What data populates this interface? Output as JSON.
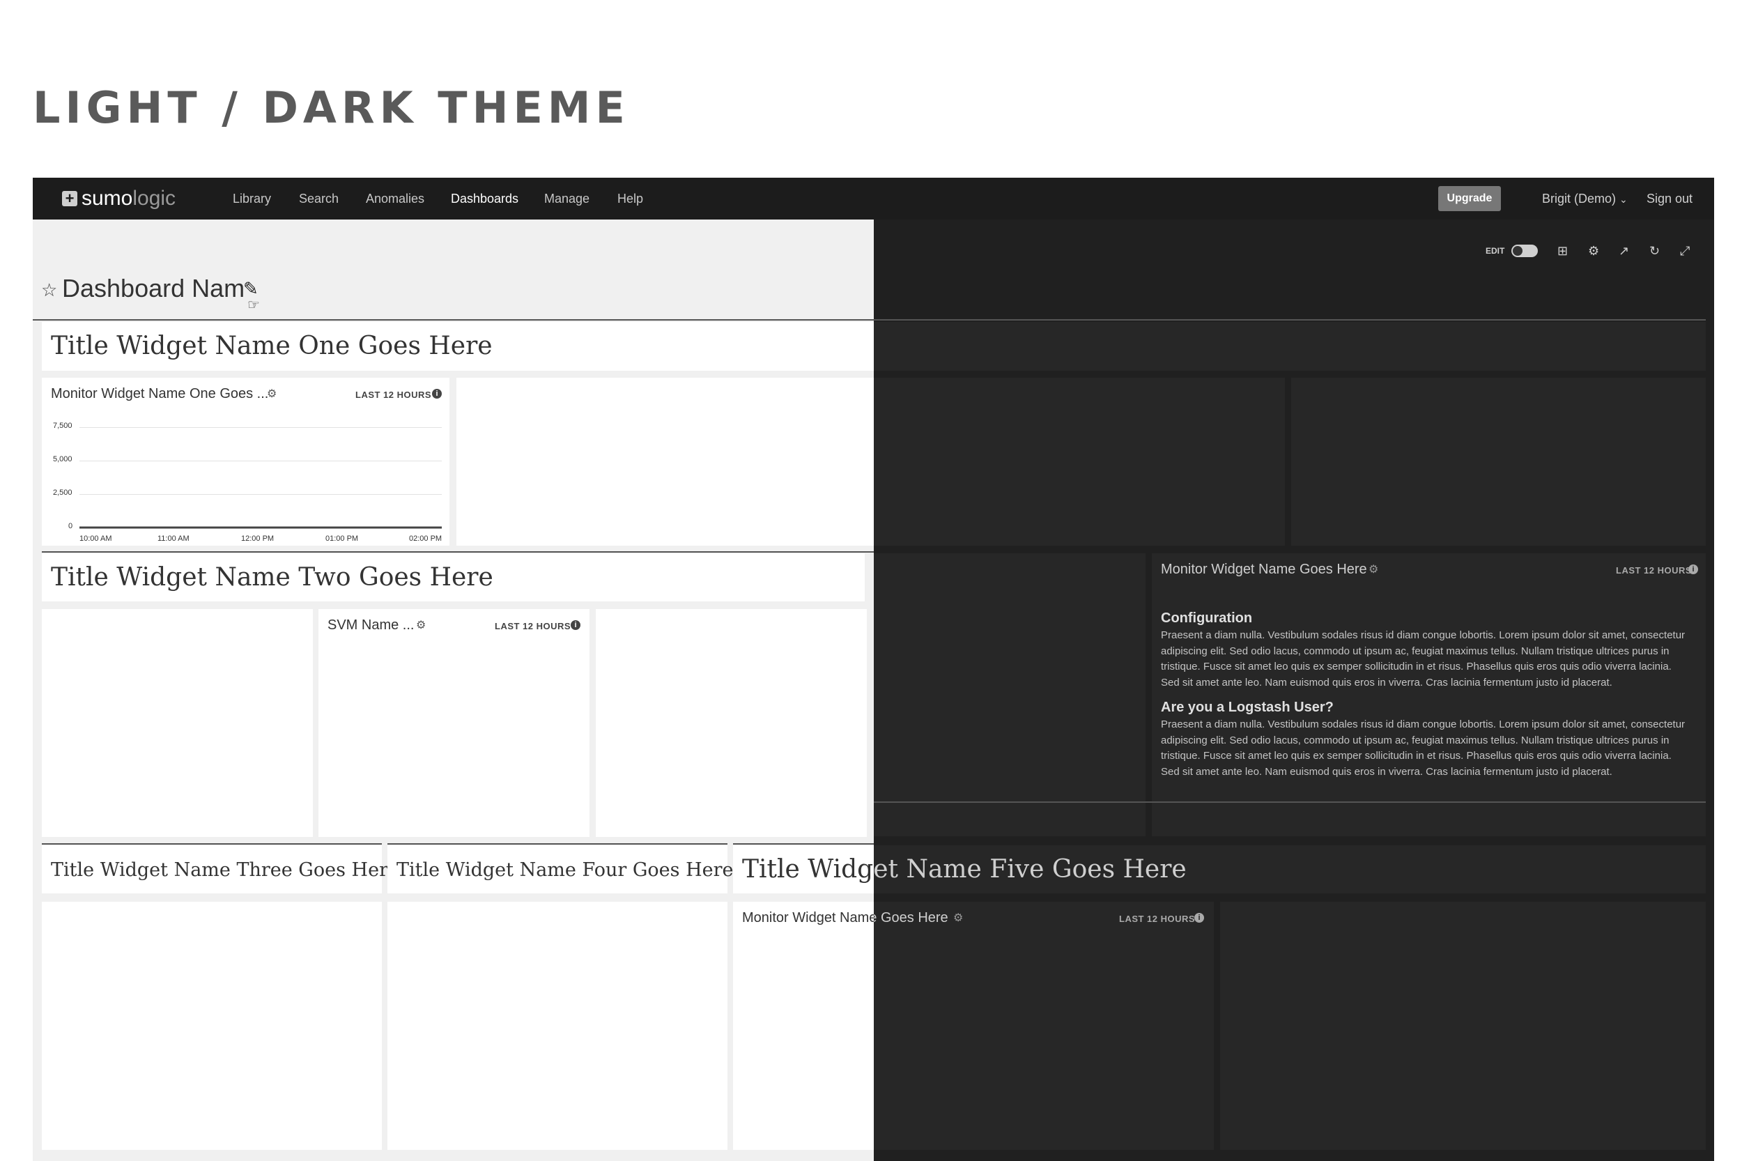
{
  "page_heading": "LIGHT / DARK THEME",
  "topbar": {
    "logo_left": "sumo",
    "logo_right": "logic",
    "nav": [
      "Library",
      "Search",
      "Anomalies",
      "Dashboards",
      "Manage",
      "Help"
    ],
    "active_nav": "Dashboards",
    "upgrade_label": "Upgrade",
    "user_label": "Brigit (Demo)",
    "signout_label": "Sign out"
  },
  "dashboard": {
    "name": "Dashboard Nam",
    "edit_label": "EDIT",
    "toolbar_icons": [
      "grid-icon",
      "gear-icon",
      "share-icon",
      "refresh-icon",
      "expand-icon"
    ]
  },
  "widgets": {
    "title_one": "Title Widget Name One Goes Here",
    "title_two": "Title Widget Name Two Goes Here",
    "title_three": "Title Widget Name Three Goes Here",
    "title_four": "Title Widget Name Four Goes Here",
    "title_five": "Title Widget Name Five Goes Here",
    "monitor_one": "Monitor Widget Name One Goes ...",
    "svm": "SVM Name ...",
    "monitor_config": "Monitor Widget Name Goes Here",
    "monitor_bottom": "Monitor Widget Name Goes Here",
    "time_range": "LAST 12 HOURS"
  },
  "config_panel": {
    "heading_one": "Configuration",
    "para_one": "Praesent a diam nulla. Vestibulum sodales risus id diam congue lobortis. Lorem ipsum dolor sit amet, consectetur adipiscing elit. Sed odio lacus, commodo ut ipsum ac, feugiat maximus tellus. Nullam tristique ultrices purus in tristique. Fusce sit amet leo quis ex semper sollicitudin in et risus. Phasellus quis eros quis odio viverra lacinia. Sed sit amet ante leo. Nam euismod quis eros in viverra. Cras lacinia fermentum justo id placerat.",
    "heading_two": "Are you a Logstash User?",
    "para_two": "Praesent a diam nulla. Vestibulum sodales risus id diam congue lobortis. Lorem ipsum dolor sit amet, consectetur adipiscing elit. Sed odio lacus, commodo ut ipsum ac, feugiat maximus tellus. Nullam tristique ultrices purus in tristique. Fusce sit amet leo quis ex semper sollicitudin in et risus. Phasellus quis eros quis odio viverra lacinia. Sed sit amet ante leo. Nam euismod quis eros in viverra. Cras lacinia fermentum justo id placerat."
  },
  "chart_data": {
    "type": "line",
    "categories": [
      "10:00 AM",
      "11:00 AM",
      "12:00 PM",
      "01:00 PM",
      "02:00 PM"
    ],
    "yticks": [
      "7,500",
      "5,000",
      "2,500",
      "0"
    ],
    "values": [
      0,
      0,
      0,
      0,
      0
    ],
    "ylim": [
      0,
      7500
    ]
  }
}
